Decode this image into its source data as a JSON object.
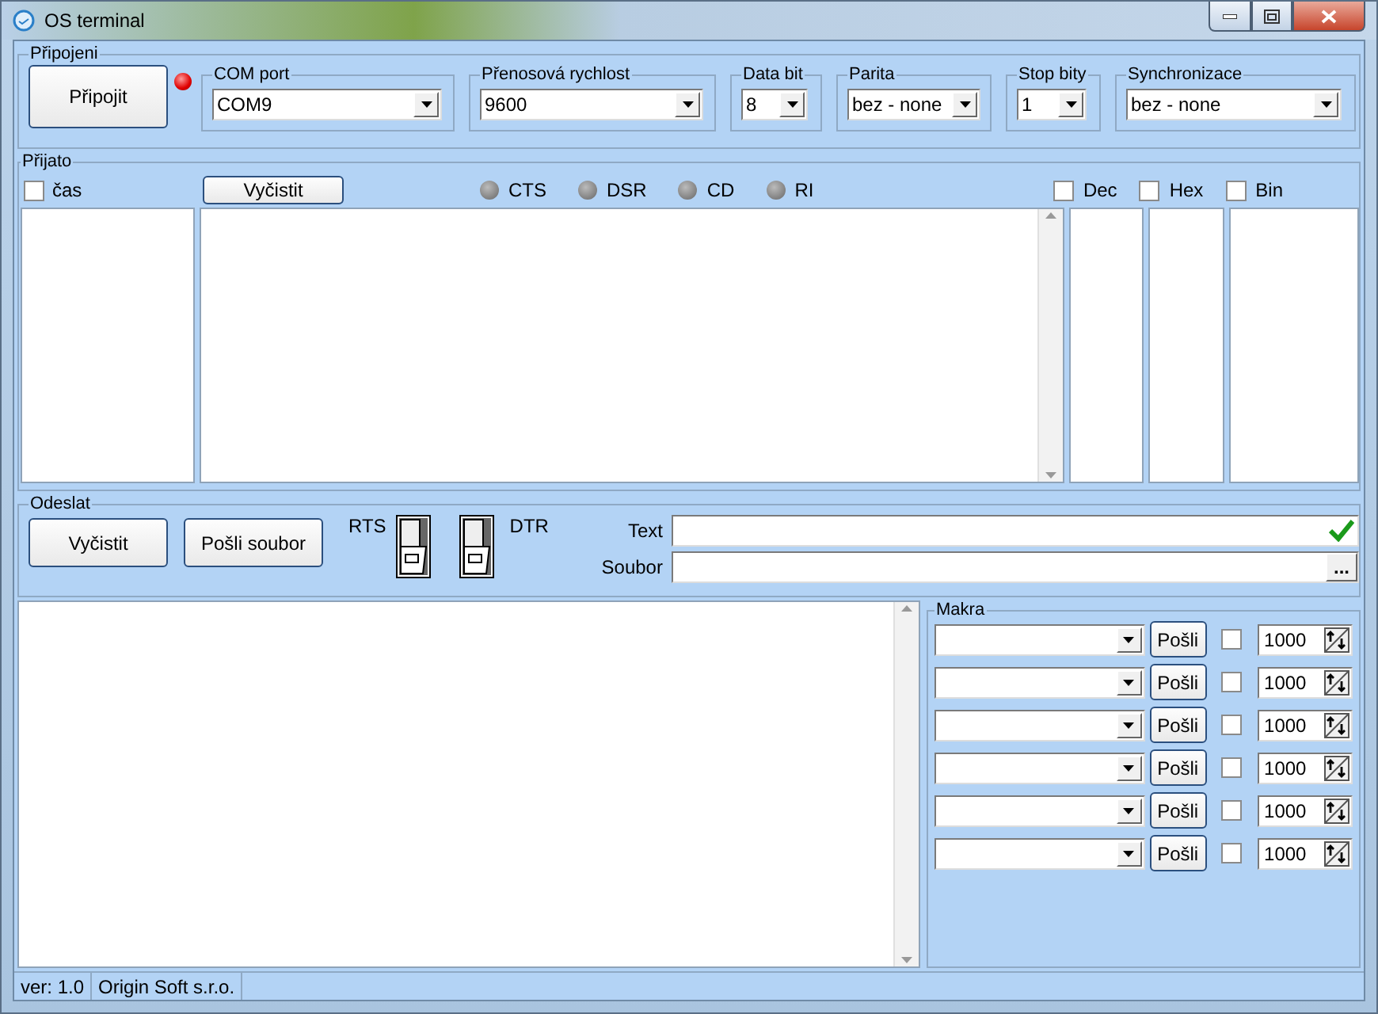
{
  "window": {
    "title": "OS terminal"
  },
  "connection": {
    "title": "Připojeni",
    "connect_button": "Připojit",
    "led_on": true,
    "settings": [
      {
        "label": "COM port",
        "value": "COM9"
      },
      {
        "label": "Přenosová rychlost",
        "value": "9600"
      },
      {
        "label": "Data bit",
        "value": "8"
      },
      {
        "label": "Parita",
        "value": "bez - none"
      },
      {
        "label": "Stop bity",
        "value": "1"
      },
      {
        "label": "Synchronizace",
        "value": "bez - none"
      }
    ]
  },
  "received": {
    "title": "Přijato",
    "time_checkbox": {
      "label": "čas",
      "checked": false
    },
    "clear_button": "Vyčistit",
    "signals": [
      {
        "label": "CTS",
        "on": false
      },
      {
        "label": "DSR",
        "on": false
      },
      {
        "label": "CD",
        "on": false
      },
      {
        "label": "RI",
        "on": false
      }
    ],
    "formats": [
      {
        "label": "Dec",
        "checked": false
      },
      {
        "label": "Hex",
        "checked": false
      },
      {
        "label": "Bin",
        "checked": false
      }
    ]
  },
  "send": {
    "title": "Odeslat",
    "buttons": [
      "Vyčistit",
      "Pošli soubor"
    ],
    "switches": [
      {
        "label": "RTS",
        "on": false
      },
      {
        "label": "DTR",
        "on": false
      }
    ],
    "fields": [
      {
        "label": "Text",
        "kind": "confirm"
      },
      {
        "label": "Soubor",
        "kind": "browse",
        "button": "..."
      }
    ]
  },
  "macros": {
    "title": "Makra",
    "rows": [
      {
        "button": "Pošli",
        "checked": false,
        "interval": "1000"
      },
      {
        "button": "Pošli",
        "checked": false,
        "interval": "1000"
      },
      {
        "button": "Pošli",
        "checked": false,
        "interval": "1000"
      },
      {
        "button": "Pošli",
        "checked": false,
        "interval": "1000"
      },
      {
        "button": "Pošli",
        "checked": false,
        "interval": "1000"
      },
      {
        "button": "Pošli",
        "checked": false,
        "interval": "1000"
      }
    ]
  },
  "status_bar": [
    "ver: 1.0",
    "Origin Soft s.r.o."
  ]
}
